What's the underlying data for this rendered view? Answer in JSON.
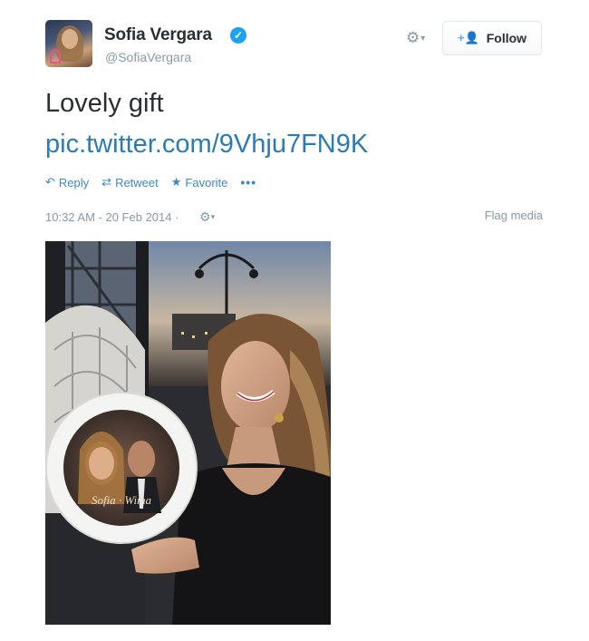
{
  "tweet": {
    "author": {
      "name": "Sofia Vergara",
      "handle": "@SofiaVergara",
      "verified_glyph": "✓"
    },
    "follow_label": "Follow",
    "text": "Lovely gift",
    "link": "pic.twitter.com/9Vhju7FN9K",
    "actions": {
      "reply": "Reply",
      "retweet": "Retweet",
      "favorite": "Favorite",
      "more": "•••"
    },
    "timestamp": "10:32 AM - 20 Feb 2014",
    "timestamp_sep": "·",
    "flag_media": "Flag media",
    "photo_plate_text": "Sofia · Wima"
  },
  "icons": {
    "verified": "verified-badge-icon",
    "gear": "gear-icon",
    "follow": "add-user-icon",
    "reply": "reply-arrow-icon",
    "retweet": "retweet-icon",
    "favorite": "star-icon",
    "more": "more-dots-icon"
  },
  "colors": {
    "link": "#2b7bb9",
    "action": "#3b88c3",
    "muted": "#8899a6",
    "verified": "#1da1f2",
    "text": "#292f33"
  }
}
